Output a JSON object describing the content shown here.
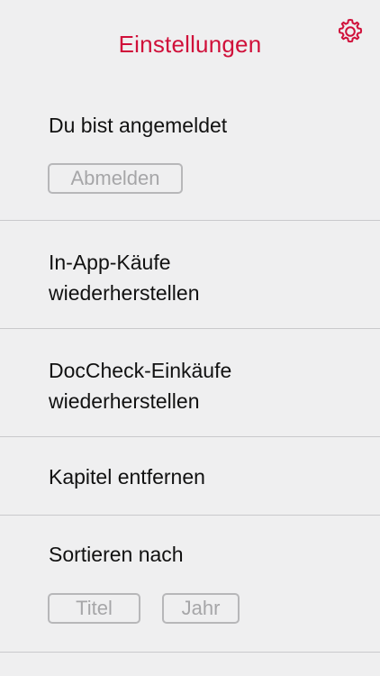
{
  "header": {
    "title": "Einstellungen",
    "settings_icon": "gear-icon",
    "accent_color": "#d0103a"
  },
  "sections": {
    "login": {
      "status": "Du bist angemeldet",
      "logout_label": "Abmelden"
    },
    "restore_iap": {
      "line1": "In-App-Käufe",
      "line2": "wiederherstellen"
    },
    "restore_doccheck": {
      "line1": "DocCheck-Einkäufe",
      "line2": "wiederherstellen"
    },
    "remove_chapters": {
      "label": "Kapitel entfernen"
    },
    "sort": {
      "label": "Sortieren nach",
      "options": [
        "Titel",
        "Jahr"
      ]
    }
  }
}
